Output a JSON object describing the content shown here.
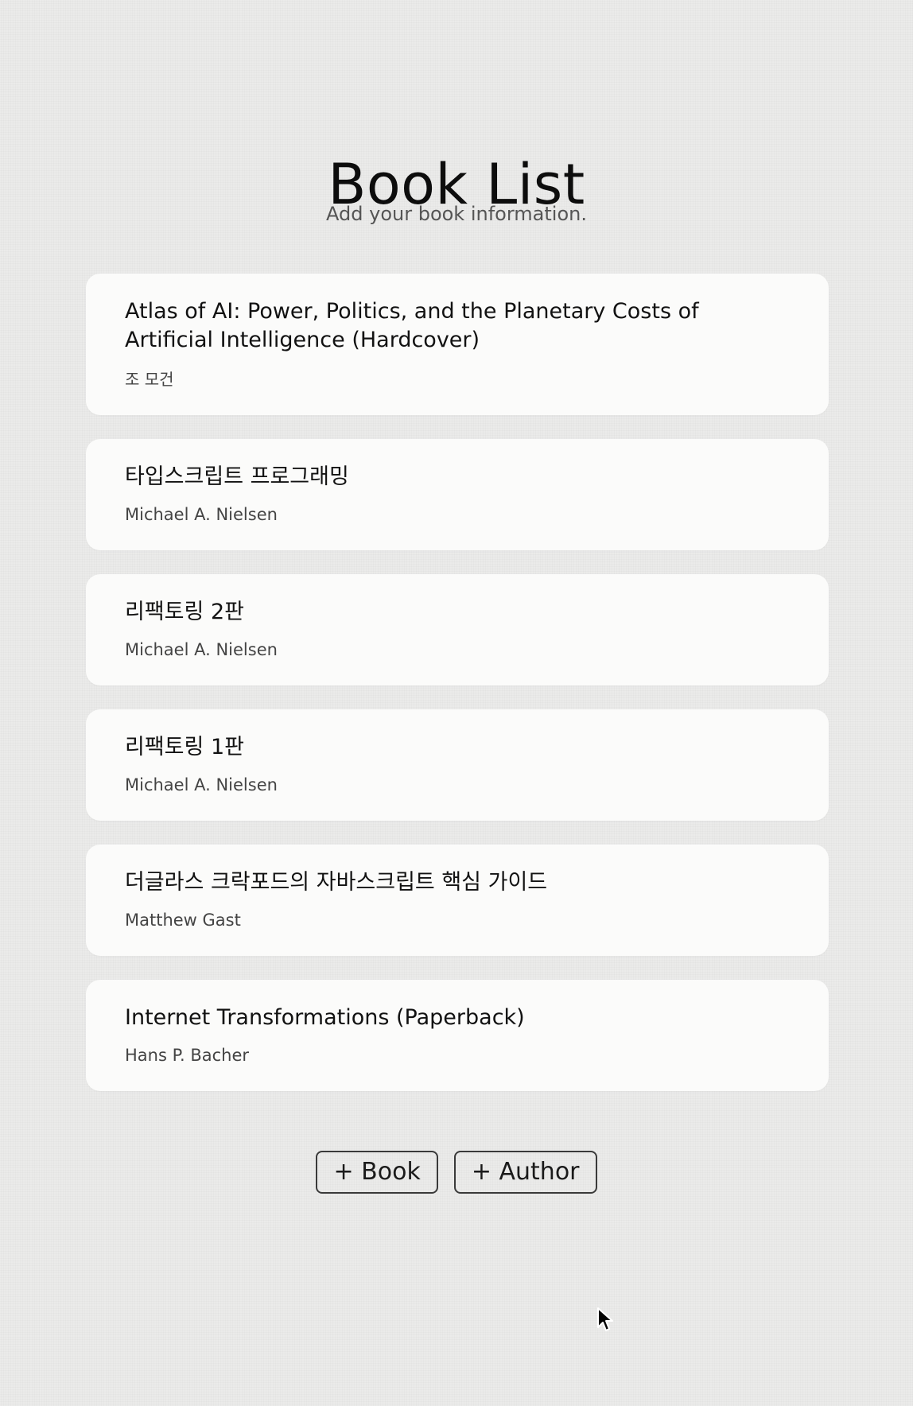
{
  "header": {
    "title": "Book List",
    "subtitle": "Add your book information."
  },
  "books": [
    {
      "title": "Atlas of AI: Power, Politics, and the Planetary Costs of Artificial Intelligence (Hardcover)",
      "author": "조 모건"
    },
    {
      "title": "타입스크립트 프로그래밍",
      "author": "Michael A. Nielsen"
    },
    {
      "title": "리팩토링 2판",
      "author": "Michael A. Nielsen"
    },
    {
      "title": "리팩토링 1판",
      "author": "Michael A. Nielsen"
    },
    {
      "title": "더글라스 크락포드의 자바스크립트 핵심 가이드",
      "author": "Matthew Gast"
    },
    {
      "title": "Internet Transformations (Paperback)",
      "author": "Hans P. Bacher"
    }
  ],
  "actions": {
    "add_book_label": "+ Book",
    "add_author_label": "+ Author"
  },
  "icons": {
    "cursor": "mouse-pointer-icon"
  },
  "colors": {
    "background": "#ebebea",
    "card": "#fbfbfa",
    "text": "#121212",
    "muted": "#555555",
    "button_border": "#3a3a3a"
  }
}
